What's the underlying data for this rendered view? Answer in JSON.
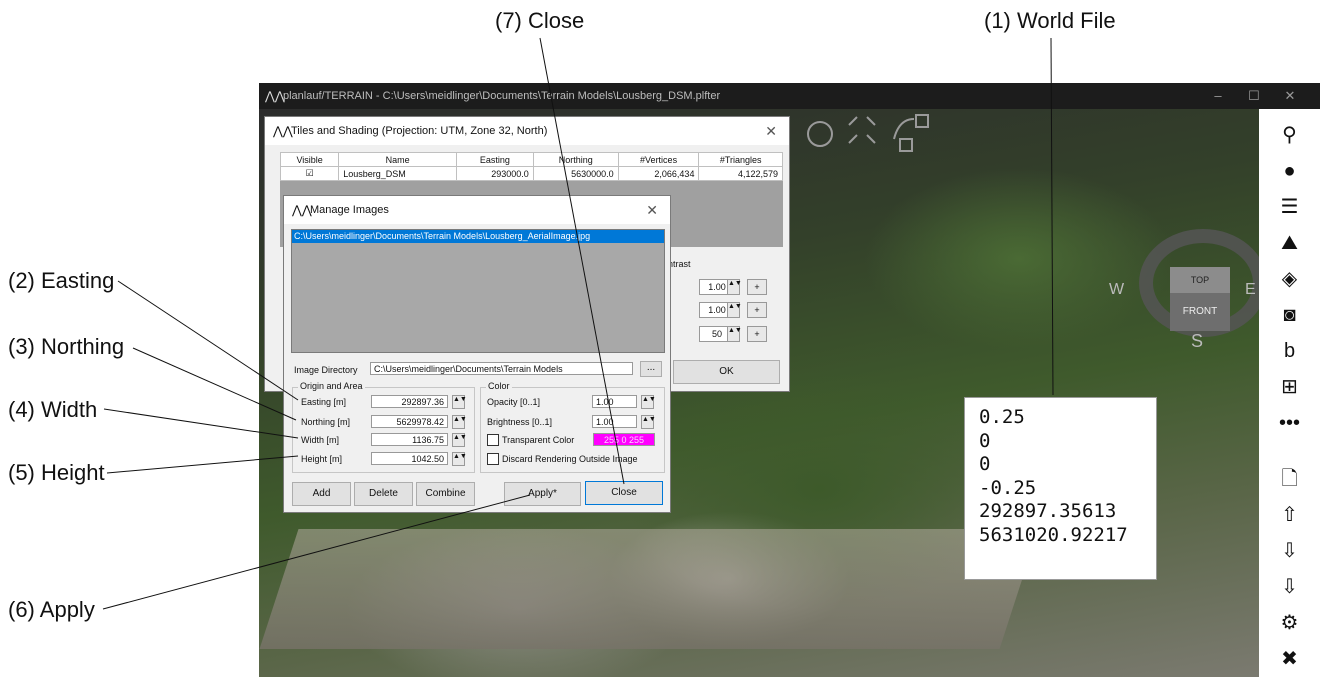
{
  "callouts": {
    "world_file": "(1) World File",
    "easting": "(2) Easting",
    "northing": "(3) Northing",
    "width": "(4) Width",
    "height": "(5) Height",
    "apply": "(6) Apply",
    "close": "(7) Close"
  },
  "app": {
    "title": "planlauf/TERRAIN - C:\\Users\\meidlinger\\Documents\\Terrain Models\\Lousberg_DSM.plfter",
    "min": "–",
    "max": "☐",
    "close": "✕"
  },
  "compass": {
    "top": "TOP",
    "front": "FRONT",
    "w": "W",
    "e": "E",
    "s": "S"
  },
  "toolbar": [
    "search-icon",
    "zoom-icon",
    "list-icon",
    "terrain-icon",
    "target-icon",
    "camera-icon",
    "bing-icon",
    "grid-icon",
    "more-icon",
    "new-file-icon",
    "upload-icon",
    "download-icon",
    "export-icon",
    "settings-icon",
    "close-icon"
  ],
  "tiles": {
    "title": "Tiles and Shading (Projection: UTM, Zone 32,  North)",
    "columns": [
      "Visible",
      "Name",
      "Easting",
      "Northing",
      "#Vertices",
      "#Triangles"
    ],
    "rows": [
      {
        "visible": "☑",
        "name": "Lousberg_DSM",
        "easting": "293000.0",
        "northing": "5630000.0",
        "vertices": "2,066,434",
        "triangles": "4,122,579"
      }
    ],
    "contrast_label": "ntrast",
    "values": [
      "1.00",
      "1.00",
      "50"
    ],
    "plus": "+",
    "ok": "OK"
  },
  "manage": {
    "title": "Manage Images",
    "selected_image": "C:\\Users\\meidlinger\\Documents\\Terrain Models\\Lousberg_AerialImage.jpg",
    "image_dir_label": "Image Directory",
    "image_dir_value": "C:\\Users\\meidlinger\\Documents\\Terrain Models",
    "browse": "...",
    "origin_group": "Origin and Area",
    "easting_label": "Easting [m]",
    "easting_value": "292897.36",
    "northing_label": "Northing [m]",
    "northing_value": "5629978.42",
    "width_label": "Width [m]",
    "width_value": "1136.75",
    "height_label": "Height [m]",
    "height_value": "1042.50",
    "color_group": "Color",
    "opacity_label": "Opacity [0..1]",
    "opacity_value": "1.00",
    "brightness_label": "Brightness [0..1]",
    "brightness_value": "1.00",
    "transparent_label": "Transparent Color",
    "transparent_value": "255 0 255",
    "discard_label": "Discard Rendering Outside Image",
    "add": "Add",
    "delete": "Delete",
    "combine": "Combine",
    "apply": "Apply*",
    "close": "Close"
  },
  "world_file_lines": [
    "0.25",
    "0",
    "0",
    "-0.25",
    "292897.35613",
    "5631020.92217"
  ],
  "colors": {
    "magenta": "#ff00ff",
    "selection": "#0078d7"
  }
}
